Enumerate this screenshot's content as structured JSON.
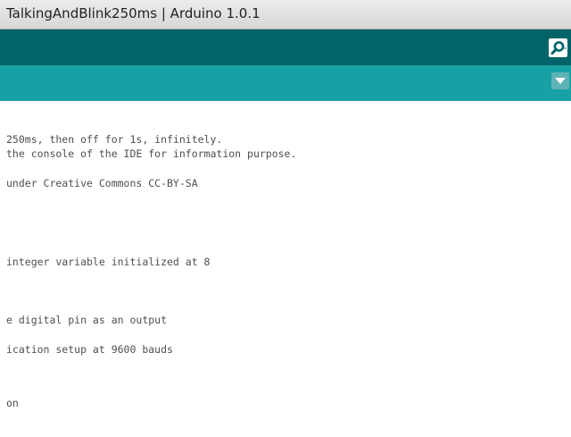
{
  "window": {
    "title": "TalkingAndBlink250ms | Arduino 1.0.1"
  },
  "toolbar": {
    "serial_monitor_icon": "magnifier-icon",
    "accent": "#006468"
  },
  "tabs": {
    "accent": "#17a1a5",
    "menu_icon": "triangle-down-icon"
  },
  "editor": {
    "lines": [
      "250ms, then off for 1s, infinitely.",
      "the console of the IDE for information purpose.",
      "under Creative Commons CC-BY-SA",
      "integer variable initialized at 8",
      "e digital pin as an output",
      "ication setup at 9600 bauds",
      "on"
    ]
  }
}
